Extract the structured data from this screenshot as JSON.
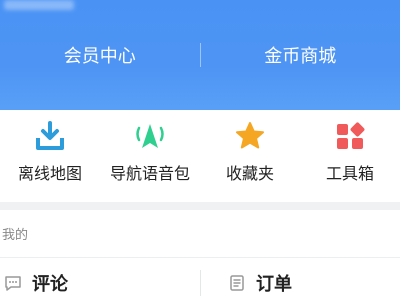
{
  "header": {
    "member_center": "会员中心",
    "coin_mall": "金币商城"
  },
  "features": [
    {
      "label": "离线地图",
      "icon": "download-icon",
      "color": "#2d9cdb"
    },
    {
      "label": "导航语音包",
      "icon": "navigation-voice-icon",
      "color": "#2fcf8f"
    },
    {
      "label": "收藏夹",
      "icon": "star-icon",
      "color": "#f5a623"
    },
    {
      "label": "工具箱",
      "icon": "toolbox-icon",
      "color": "#f05a5a"
    }
  ],
  "mine": {
    "title": "我的",
    "items": [
      {
        "label": "评论",
        "icon": "comment-icon"
      },
      {
        "label": "订单",
        "icon": "order-icon"
      }
    ]
  }
}
